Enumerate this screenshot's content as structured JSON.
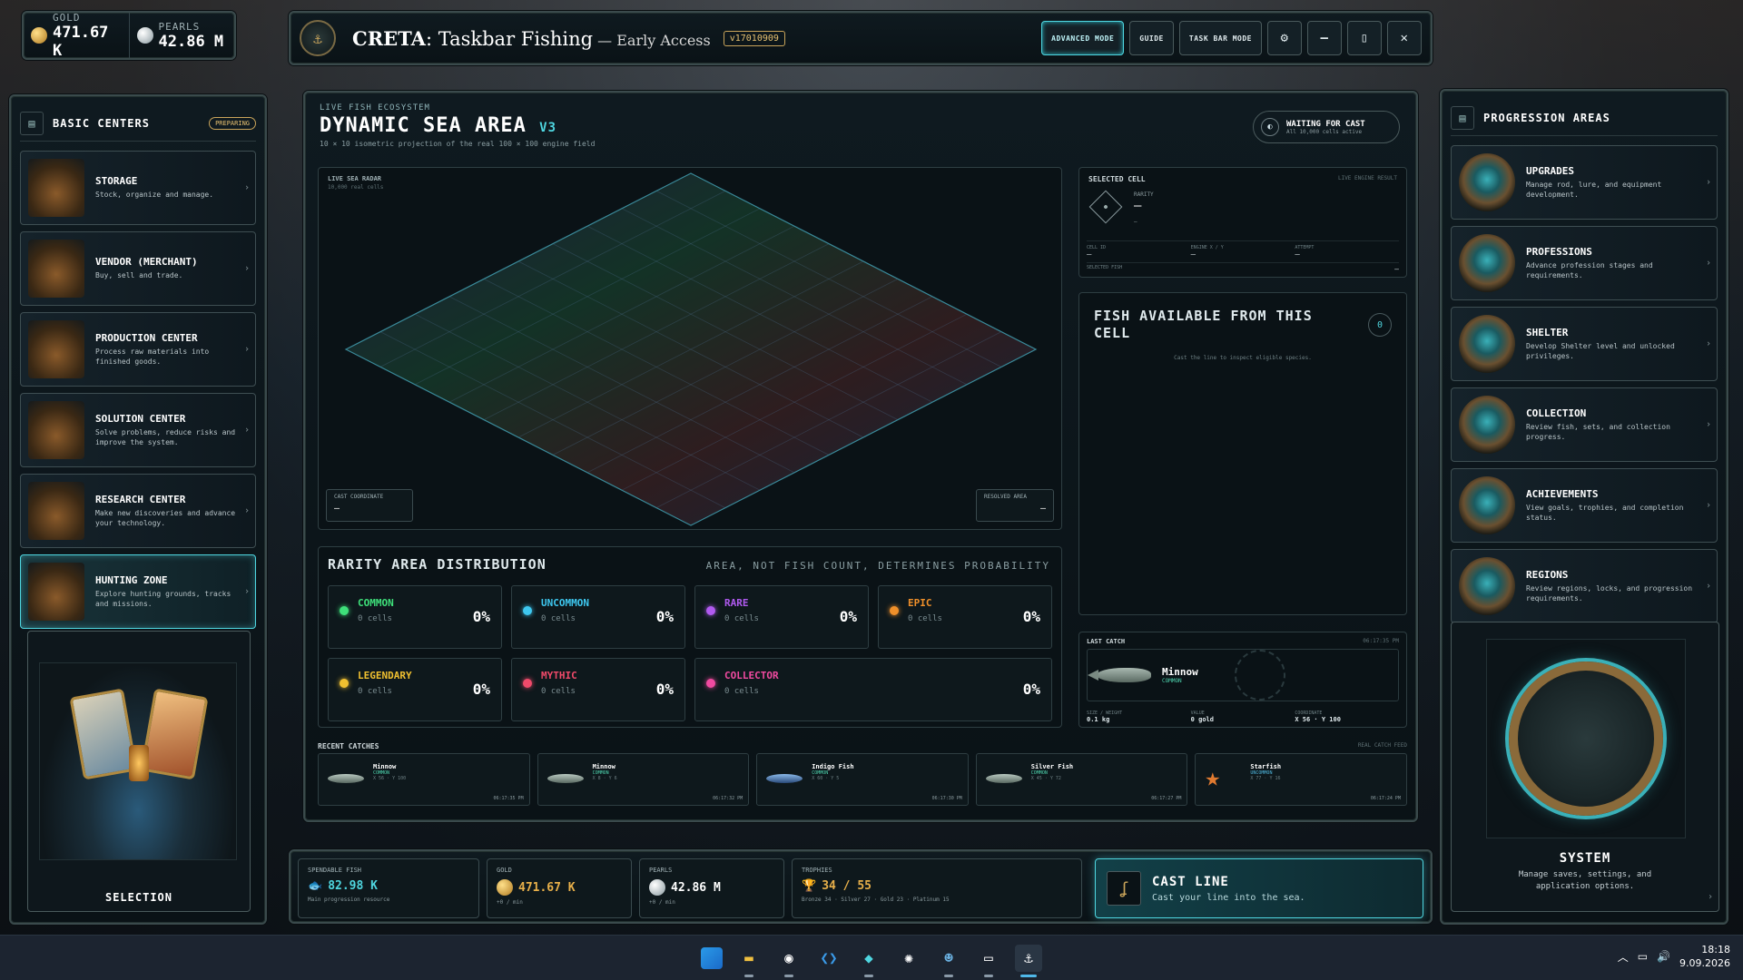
{
  "resources": {
    "gold_label": "GOLD",
    "gold_value": "471.67 K",
    "pearls_label": "PEARLS",
    "pearls_value": "42.86 M"
  },
  "titlebar": {
    "title_bold": "CRETA",
    "title_rest": ": Taskbar Fishing",
    "subtitle": " — Early Access",
    "version": "v17010909",
    "buttons": [
      "ADVANCED MODE",
      "GUIDE",
      "TASK BAR MODE"
    ],
    "icons": [
      "settings-icon",
      "minimize-icon",
      "restore-icon",
      "close-icon"
    ],
    "minimize": "–",
    "restore": "▯",
    "close": "✕"
  },
  "left": {
    "title": "BASIC CENTERS",
    "badge": "PREPARING",
    "items": [
      {
        "name": "STORAGE",
        "desc": "Stock, organize and manage."
      },
      {
        "name": "VENDOR (MERCHANT)",
        "desc": "Buy, sell and trade."
      },
      {
        "name": "PRODUCTION CENTER",
        "desc": "Process raw materials into finished goods."
      },
      {
        "name": "SOLUTION CENTER",
        "desc": "Solve problems, reduce risks and improve the system."
      },
      {
        "name": "RESEARCH CENTER",
        "desc": "Make new discoveries and advance your technology."
      },
      {
        "name": "HUNTING ZONE",
        "desc": "Explore hunting grounds, tracks and missions."
      }
    ],
    "selection_title": "SELECTION"
  },
  "right": {
    "title": "PROGRESSION AREAS",
    "items": [
      {
        "name": "UPGRADES",
        "desc": "Manage rod, lure, and equipment development."
      },
      {
        "name": "PROFESSIONS",
        "desc": "Advance profession stages and requirements."
      },
      {
        "name": "SHELTER",
        "desc": "Develop Shelter level and unlocked privileges."
      },
      {
        "name": "COLLECTION",
        "desc": "Review fish, sets, and collection progress."
      },
      {
        "name": "ACHIEVEMENTS",
        "desc": "View goals, trophies, and completion status."
      },
      {
        "name": "REGIONS",
        "desc": "Review regions, locks, and progression requirements."
      }
    ],
    "system_title": "SYSTEM",
    "system_desc": "Manage saves, settings, and application options."
  },
  "center": {
    "eyebrow": "LIVE FISH ECOSYSTEM",
    "title": "DYNAMIC SEA AREA",
    "title_version": "V3",
    "desc": "10 × 10 isometric projection of the real 100 × 100 engine field",
    "status_title": "WAITING FOR CAST",
    "status_sub": "All 10,000 cells active",
    "radar": {
      "label": "LIVE SEA RADAR",
      "sub": "10,000 real cells",
      "grid_n": 10,
      "cast_label": "CAST COORDINATE",
      "cast_value": "—",
      "resolved_label": "RESOLVED AREA",
      "resolved_value": "—"
    },
    "selected_cell": {
      "title": "SELECTED CELL",
      "right": "LIVE ENGINE RESULT",
      "rarity_label": "RARITY",
      "rarity_value": "—",
      "rarity_sub": "—",
      "fields": [
        {
          "label": "CELL ID",
          "value": "—"
        },
        {
          "label": "ENGINE X / Y",
          "value": "—"
        },
        {
          "label": "ATTEMPT",
          "value": "—"
        }
      ],
      "selected_fish_label": "SELECTED FISH",
      "selected_fish_value": "—"
    },
    "fish_available": {
      "title": "FISH AVAILABLE FROM THIS CELL",
      "count": "0",
      "hint": "Cast the line to inspect eligible species."
    },
    "last_catch": {
      "title": "LAST CATCH",
      "time": "06:17:35 PM",
      "name": "Minnow",
      "rarity": "COMMON",
      "fields": [
        {
          "label": "SIZE / WEIGHT",
          "value": "0.1 kg"
        },
        {
          "label": "VALUE",
          "value": "0 gold"
        },
        {
          "label": "COORDINATE",
          "value": "X 56 · Y 100"
        }
      ]
    },
    "rarity_dist": {
      "title": "RARITY AREA DISTRIBUTION",
      "note": "AREA, NOT FISH COUNT, DETERMINES PROBABILITY",
      "items": [
        {
          "name": "COMMON",
          "cells": "0 cells",
          "pct": "0%",
          "color": "#3ee07a"
        },
        {
          "name": "UNCOMMON",
          "cells": "0 cells",
          "pct": "0%",
          "color": "#3ec8f0"
        },
        {
          "name": "RARE",
          "cells": "0 cells",
          "pct": "0%",
          "color": "#b05af0"
        },
        {
          "name": "EPIC",
          "cells": "0 cells",
          "pct": "0%",
          "color": "#f0902a"
        },
        {
          "name": "LEGENDARY",
          "cells": "0 cells",
          "pct": "0%",
          "color": "#f0c030"
        },
        {
          "name": "MYTHIC",
          "cells": "0 cells",
          "pct": "0%",
          "color": "#f04a6a"
        },
        {
          "name": "COLLECTOR",
          "cells": "0 cells",
          "pct": "0%",
          "color": "#f04aa0"
        }
      ]
    },
    "recent": {
      "title": "RECENT CATCHES",
      "right": "REAL CATCH FEED",
      "items": [
        {
          "name": "Minnow",
          "rarity": "COMMON",
          "coord": "X 56 · Y 100",
          "time": "06:17:35 PM",
          "type": "fish"
        },
        {
          "name": "Minnow",
          "rarity": "COMMON",
          "coord": "X 8 · Y 6",
          "time": "06:17:32 PM",
          "type": "fish"
        },
        {
          "name": "Indigo Fish",
          "rarity": "COMMON",
          "coord": "X 60 · Y 5",
          "time": "06:17:30 PM",
          "type": "blue"
        },
        {
          "name": "Silver Fish",
          "rarity": "COMMON",
          "coord": "X 45 · Y 72",
          "time": "06:17:27 PM",
          "type": "fish"
        },
        {
          "name": "Starfish",
          "rarity": "UNCOMMON",
          "coord": "X 77 · Y 16",
          "time": "06:17:24 PM",
          "type": "star"
        }
      ]
    }
  },
  "bottom": {
    "spendable_label": "SPENDABLE FISH",
    "spendable_value": "82.98 K",
    "spendable_sub": "Main progression resource",
    "gold_label": "GOLD",
    "gold_value": "471.67 K",
    "gold_sub": "+0 / min",
    "pearls_label": "PEARLS",
    "pearls_value": "42.86 M",
    "pearls_sub": "+0 / min",
    "trophies_label": "TROPHIES",
    "trophies_value": "34 / 55",
    "trophies_sub": "Bronze 34 · Silver 27 · Gold 23 · Platinum 15",
    "cast_title": "CAST LINE",
    "cast_desc": "Cast your line into the sea."
  },
  "taskbar": {
    "apps": [
      "windows-start-icon",
      "file-explorer-icon",
      "steam-icon",
      "vscode-icon",
      "app-icon",
      "chatgpt-icon",
      "godot-icon",
      "terminal-icon",
      "creta-icon"
    ],
    "time": "18:18",
    "date": "9.09.2026"
  },
  "colors": {
    "accent": "#4fd6e0",
    "gold": "#e8b04a",
    "panel": "#0a1216"
  }
}
